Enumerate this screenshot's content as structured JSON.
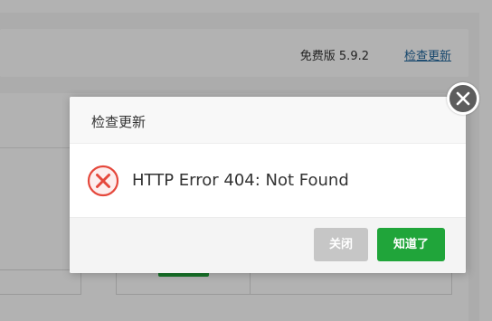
{
  "background": {
    "version_text": "免费版 5.9.2",
    "check_update_link": "检查更新"
  },
  "dialog": {
    "title": "检查更新",
    "message": "HTTP Error 404: Not Found",
    "icon": "error-x-icon",
    "buttons": {
      "close_label": "关闭",
      "ok_label": "知道了"
    },
    "close_icon": "close-icon"
  },
  "colors": {
    "accent_green": "#20a53a",
    "error_red": "#e5483c",
    "disabled_gray": "#c6c6c6",
    "link_blue": "#20669c"
  }
}
